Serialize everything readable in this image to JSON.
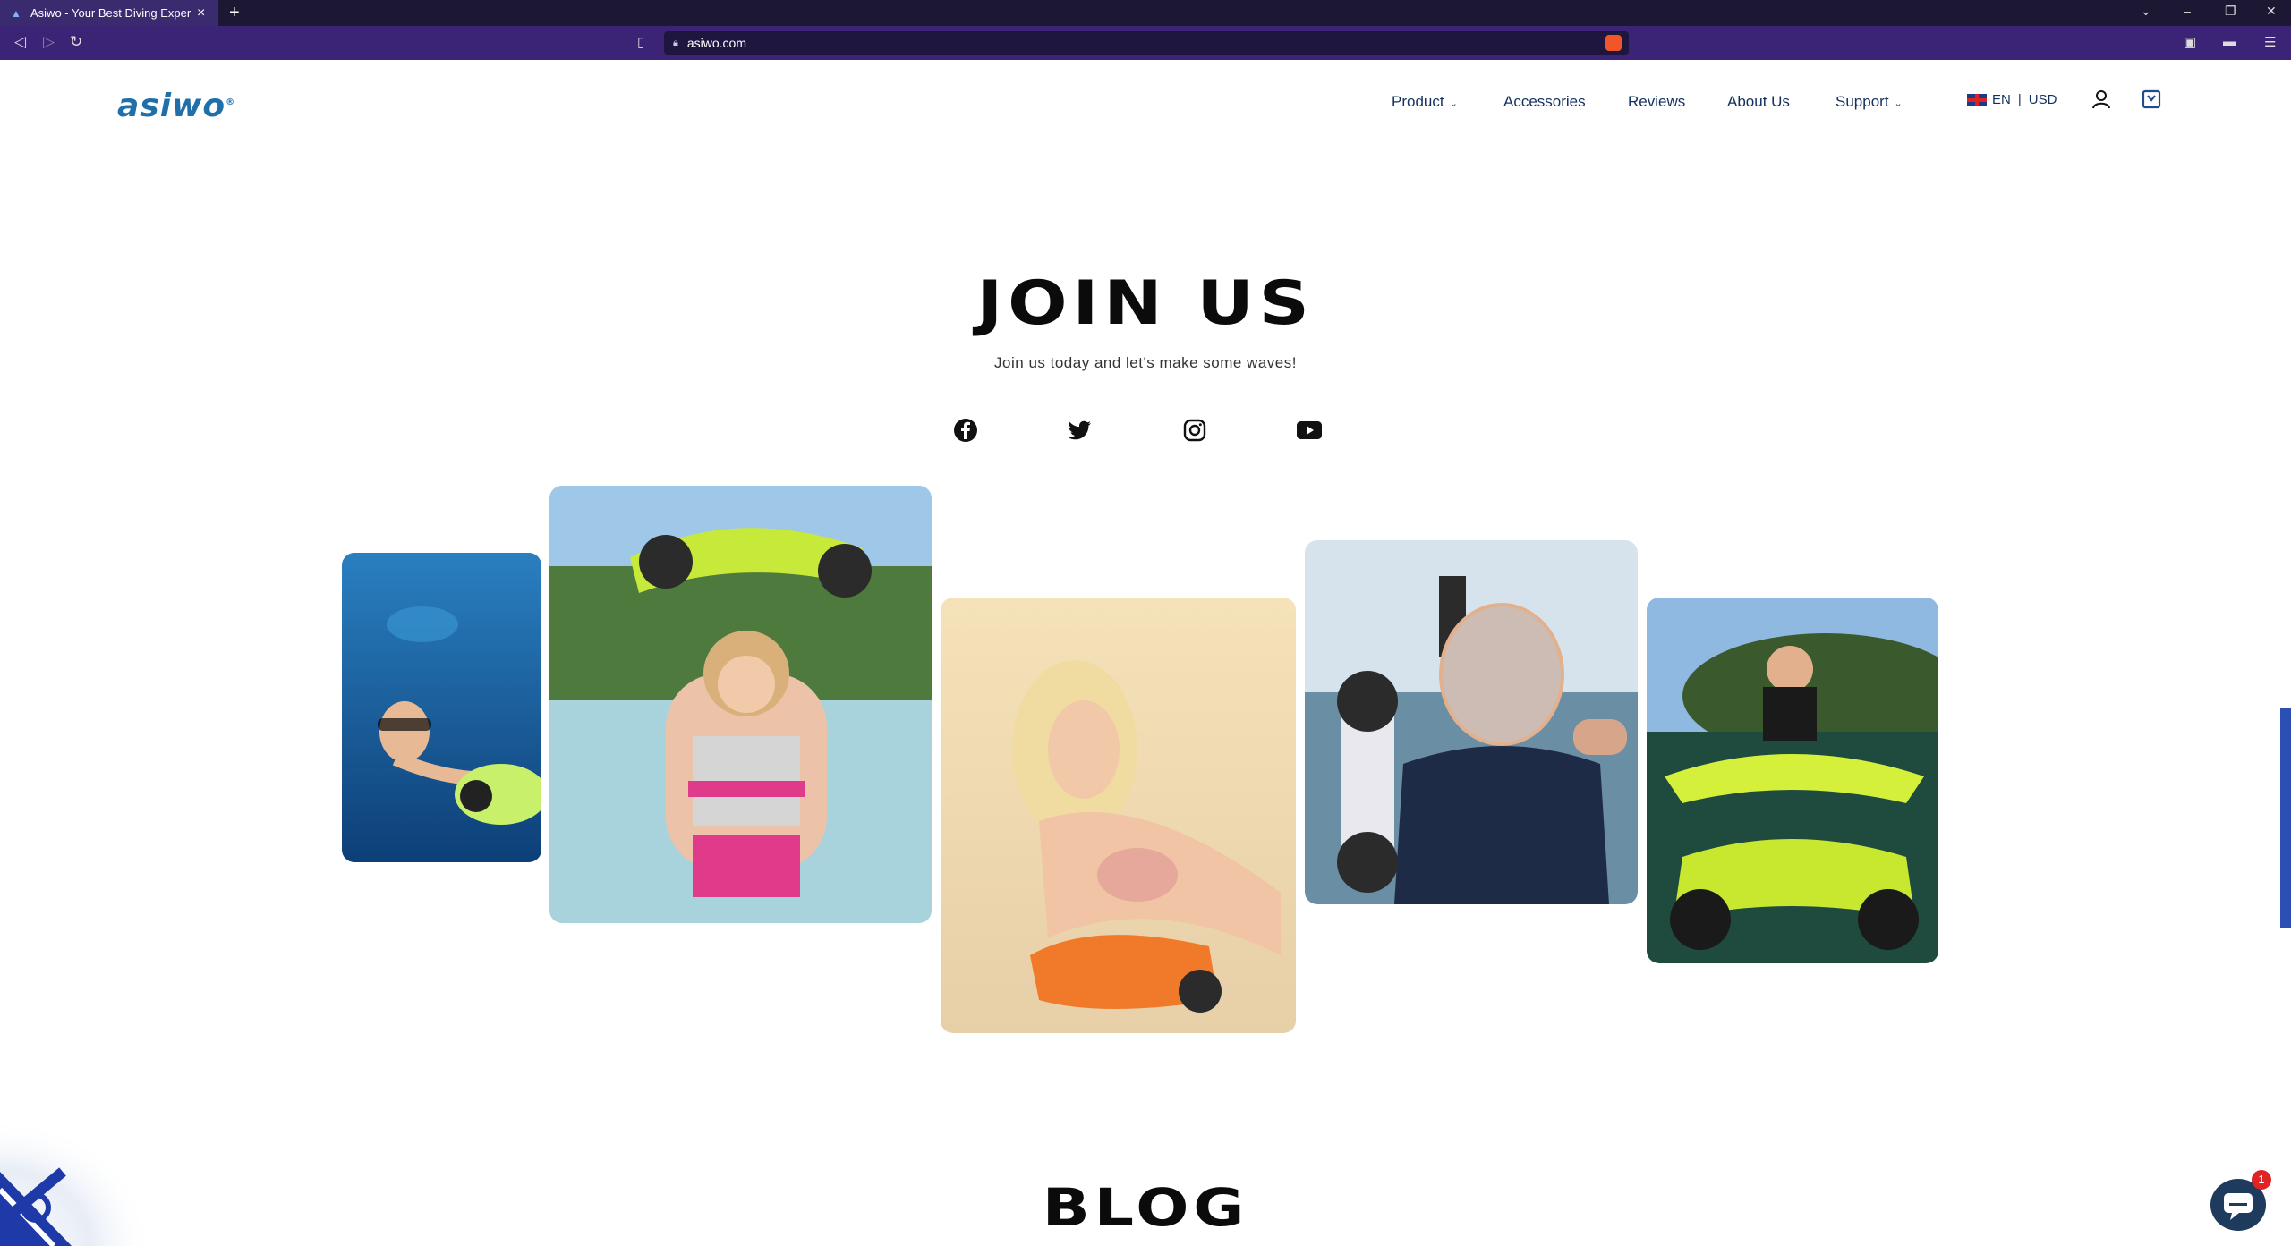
{
  "browser": {
    "tab_title": "Asiwo - Your Best Diving Experien",
    "url": "asiwo.com"
  },
  "site": {
    "logo": "asiwo",
    "nav": [
      {
        "label": "Product",
        "has_dropdown": true
      },
      {
        "label": "Accessories",
        "has_dropdown": false
      },
      {
        "label": "Reviews",
        "has_dropdown": false
      },
      {
        "label": "About Us",
        "has_dropdown": false
      },
      {
        "label": "Support",
        "has_dropdown": true
      }
    ],
    "lang": "EN",
    "currency": "USD",
    "divider": "|"
  },
  "hero": {
    "title": "JOIN US",
    "subtitle": "Join us today and let's make some waves!",
    "social": [
      "facebook-icon",
      "twitter-icon",
      "instagram-icon",
      "youtube-icon"
    ]
  },
  "gallery": [
    {
      "desc": "child-swimming-underwater"
    },
    {
      "desc": "girl-holding-scooter"
    },
    {
      "desc": "woman-on-beach"
    },
    {
      "desc": "man-with-snorkel-mask"
    },
    {
      "desc": "woman-with-yellow-scooter"
    }
  ],
  "blog": {
    "title": "BLOG"
  },
  "chat": {
    "badge": "1"
  },
  "colors": {
    "brand": "#1f6fa8",
    "nav_text": "#12315e",
    "chrome_tab": "#1c1733",
    "chrome_addr": "#3b2475"
  }
}
